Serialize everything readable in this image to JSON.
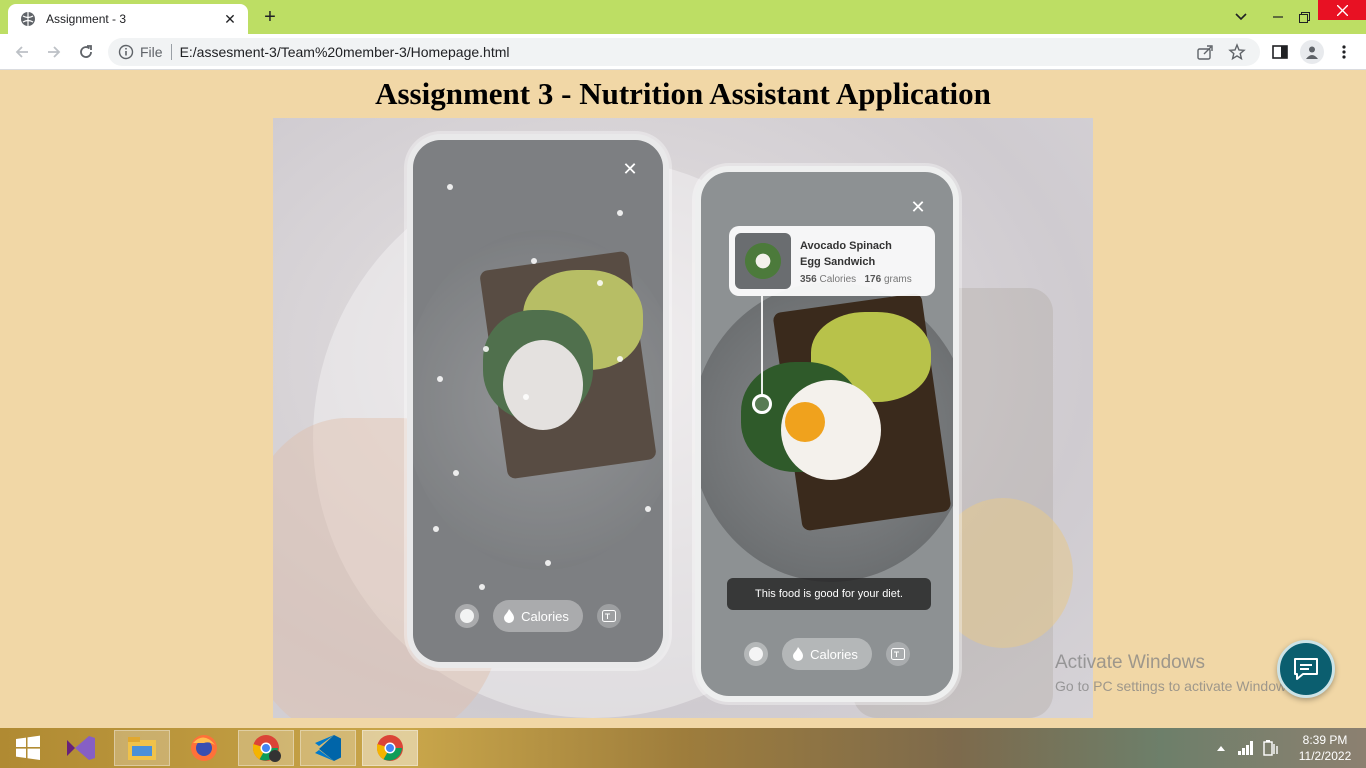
{
  "browser": {
    "tab_title": "Assignment - 3",
    "new_tab_symbol": "+",
    "address_scheme": "File",
    "url": "E:/assesment-3/Team%20member-3/Homepage.html"
  },
  "page": {
    "title": "Assignment 3 - Nutrition Assistant Application"
  },
  "hero": {
    "phone_left": {
      "close_symbol": "✕",
      "pill_label": "Calories"
    },
    "phone_right": {
      "close_symbol": "✕",
      "food_name_line1": "Avocado Spinach",
      "food_name_line2": "Egg Sandwich",
      "calories_value": "356",
      "calories_unit": "Calories",
      "weight_value": "176",
      "weight_unit": "grams",
      "diet_message": "This food is good for your diet.",
      "pill_label": "Calories"
    }
  },
  "watermark": {
    "heading": "Activate Windows",
    "subtext": "Go to PC settings to activate Windows."
  },
  "taskbar": {
    "apps": [
      "start-icon",
      "visual-studio-icon",
      "file-explorer-icon",
      "firefox-icon",
      "chrome-icon",
      "vscode-icon",
      "chrome-active-icon"
    ],
    "time": "8:39 PM",
    "date": "11/2/2022"
  },
  "colors": {
    "tabbar": "#bdde64",
    "page_background": "#f1d7a6",
    "close_button": "#e81123",
    "chat_fab": "#0b5e6f"
  }
}
